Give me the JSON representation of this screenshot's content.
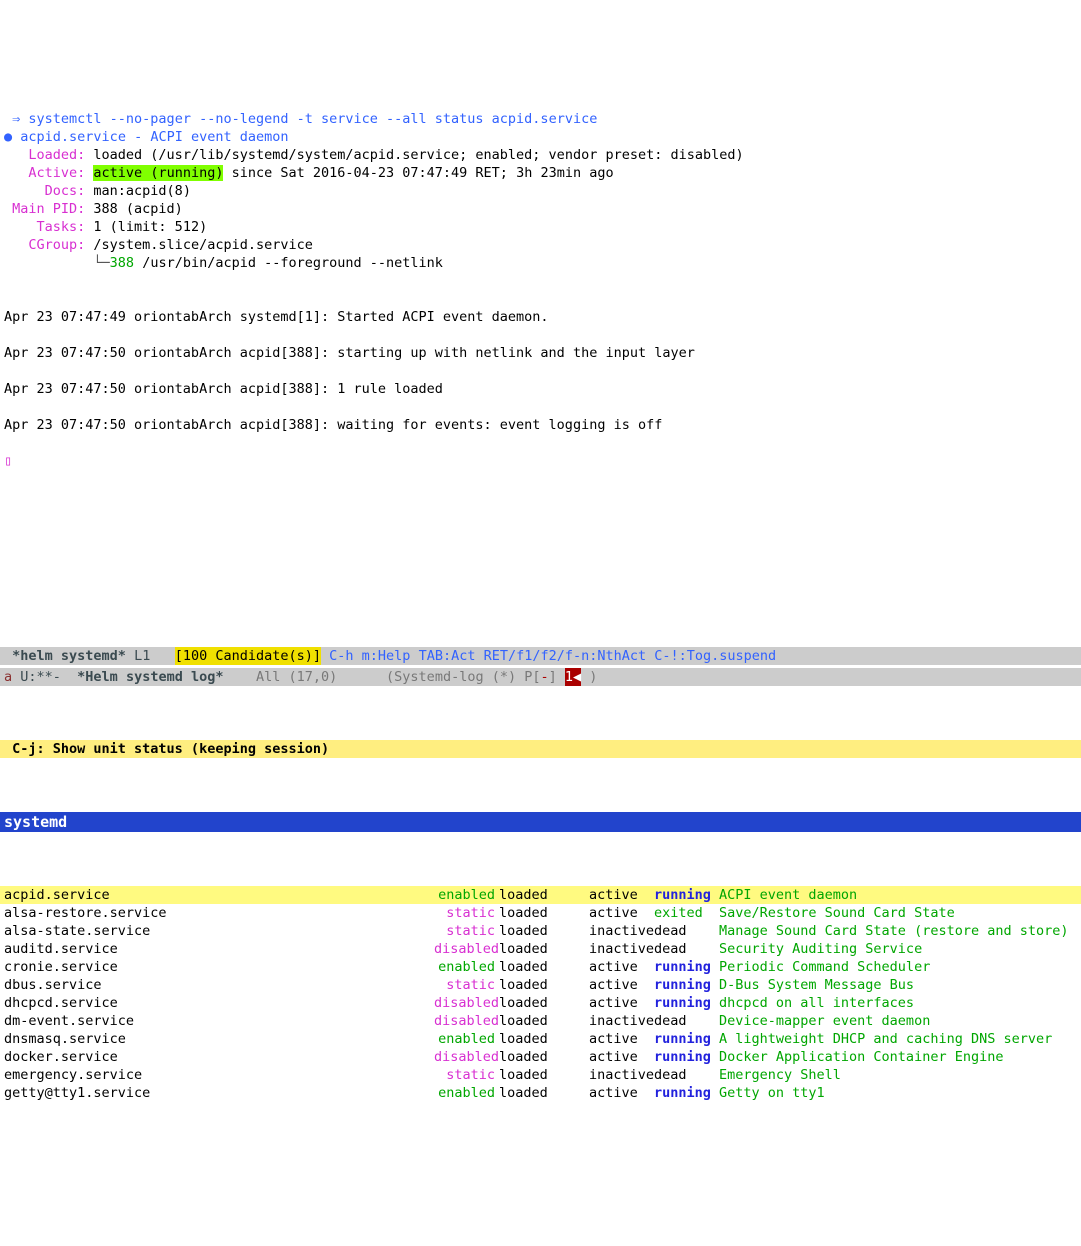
{
  "top": {
    "prompt": " ⇒ ",
    "command": "systemctl --no-pager --no-legend -t service --all status acpid.service",
    "bullet": "●",
    "unit_line": "acpid.service - ACPI event daemon",
    "labels": {
      "loaded": "   Loaded:",
      "active": "   Active:",
      "docs": "     Docs:",
      "mainpid": " Main PID:",
      "tasks": "    Tasks:",
      "cgroup": "   CGroup:"
    },
    "loaded_value": " loaded (/usr/lib/systemd/system/acpid.service; enabled; vendor preset: disabled)",
    "active_value_pre": " ",
    "active_value_hl": "active (running)",
    "active_value_post": " since Sat 2016-04-23 07:47:49 RET; 3h 23min ago",
    "docs_value": " man:acpid(8)",
    "mainpid_value": " 388 (acpid)",
    "tasks_value": " 1 (limit: 512)",
    "cgroup_value": " /system.slice/acpid.service",
    "tree_prefix": "           └─",
    "tree_pid": "388",
    "tree_cmd": " /usr/bin/acpid --foreground --netlink",
    "logs": [
      "Apr 23 07:47:49 oriontabArch systemd[1]: Started ACPI event daemon.",
      "Apr 23 07:47:50 oriontabArch acpid[388]: starting up with netlink and the input layer",
      "Apr 23 07:47:50 oriontabArch acpid[388]: 1 rule loaded",
      "Apr 23 07:47:50 oriontabArch acpid[388]: waiting for events: event logging is off"
    ],
    "cursor": "▯"
  },
  "modeline1": {
    "a": "a",
    "flags": " U:**- ",
    "buffer": " *Helm systemd log* ",
    "pos": "   All (17,0)      ",
    "mode_pre": "(Systemd-log (*) P[",
    "mode_dash": "-",
    "mode_mid": "] ",
    "mode_red": "1◀",
    "mode_post": " )"
  },
  "yellow_bar": " C-j: Show unit status (keeping session)",
  "helm_header": "systemd",
  "services": [
    {
      "name": "acpid.service",
      "state": "enabled",
      "load": "loaded",
      "active": "active",
      "sub": "running",
      "subclass": "sub-running",
      "desc": "ACPI event daemon",
      "sel": true
    },
    {
      "name": "alsa-restore.service",
      "state": "static",
      "load": "loaded",
      "active": "active",
      "sub": "exited",
      "subclass": "sub-exited",
      "desc": "Save/Restore Sound Card State"
    },
    {
      "name": "alsa-state.service",
      "state": "static",
      "load": "loaded",
      "active": "inactive",
      "sub": "dead",
      "subclass": "sub-dead",
      "desc": "Manage Sound Card State (restore and store)"
    },
    {
      "name": "auditd.service",
      "state": "disabled",
      "load": "loaded",
      "active": "inactive",
      "sub": "dead",
      "subclass": "sub-dead",
      "desc": "Security Auditing Service"
    },
    {
      "name": "cronie.service",
      "state": "enabled",
      "load": "loaded",
      "active": "active",
      "sub": "running",
      "subclass": "sub-running",
      "desc": "Periodic Command Scheduler"
    },
    {
      "name": "dbus.service",
      "state": "static",
      "load": "loaded",
      "active": "active",
      "sub": "running",
      "subclass": "sub-running",
      "desc": "D-Bus System Message Bus"
    },
    {
      "name": "dhcpcd.service",
      "state": "disabled",
      "load": "loaded",
      "active": "active",
      "sub": "running",
      "subclass": "sub-running",
      "desc": "dhcpcd on all interfaces"
    },
    {
      "name": "dm-event.service",
      "state": "disabled",
      "load": "loaded",
      "active": "inactive",
      "sub": "dead",
      "subclass": "sub-dead",
      "desc": "Device-mapper event daemon"
    },
    {
      "name": "dnsmasq.service",
      "state": "enabled",
      "load": "loaded",
      "active": "active",
      "sub": "running",
      "subclass": "sub-running",
      "desc": "A lightweight DHCP and caching DNS server"
    },
    {
      "name": "docker.service",
      "state": "disabled",
      "load": "loaded",
      "active": "active",
      "sub": "running",
      "subclass": "sub-running",
      "desc": "Docker Application Container Engine"
    },
    {
      "name": "emergency.service",
      "state": "static",
      "load": "loaded",
      "active": "inactive",
      "sub": "dead",
      "subclass": "sub-dead",
      "desc": "Emergency Shell"
    },
    {
      "name": "getty@tty1.service",
      "state": "enabled",
      "load": "loaded",
      "active": "active",
      "sub": "running",
      "subclass": "sub-running",
      "desc": "Getty on tty1"
    }
  ],
  "modeline2": {
    "prefix": " ",
    "buffer": "*helm systemd*",
    "line": " L1   ",
    "cands": "[100 Candidate(s)]",
    "help": " C-h m:Help TAB:Act RET/f1/f2/f-n:NthAct C-!:Tog.suspend"
  }
}
